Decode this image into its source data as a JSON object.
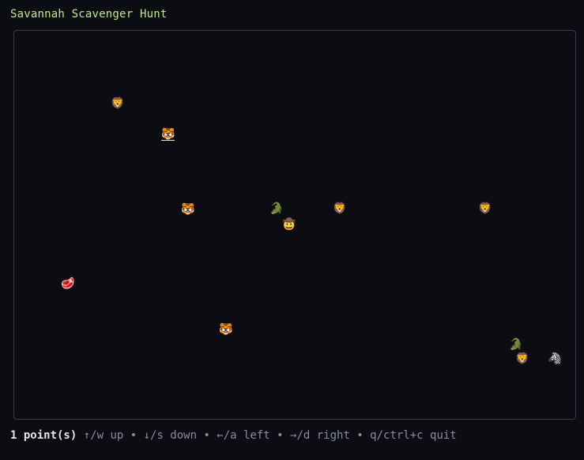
{
  "title": "Savannah Scavenger Hunt",
  "footer": {
    "score": "1 point(s)",
    "hints": " ↑/w up • ↓/s down • ←/a left • →/d right • q/ctrl+c quit"
  },
  "entities": [
    {
      "name": "lion-icon",
      "glyph": "🦁"
    },
    {
      "name": "tiger-icon",
      "glyph": "🐯"
    },
    {
      "name": "tiger-icon",
      "glyph": "🐯"
    },
    {
      "name": "crocodile-icon",
      "glyph": "🐊"
    },
    {
      "name": "player-cowboy-icon",
      "glyph": "🤠"
    },
    {
      "name": "lion-icon",
      "glyph": "🦁"
    },
    {
      "name": "lion-icon",
      "glyph": "🦁"
    },
    {
      "name": "meat-icon",
      "glyph": "🥩"
    },
    {
      "name": "tiger-icon",
      "glyph": "🐯"
    },
    {
      "name": "crocodile-icon",
      "glyph": "🐊"
    },
    {
      "name": "lion-icon",
      "glyph": "🦁"
    },
    {
      "name": "zebra-icon",
      "glyph": "🦓"
    }
  ],
  "colors": {
    "background": "#0c0d12",
    "title": "#c3e88d",
    "border": "#3a3d46",
    "footer_text": "#8a8d96"
  }
}
